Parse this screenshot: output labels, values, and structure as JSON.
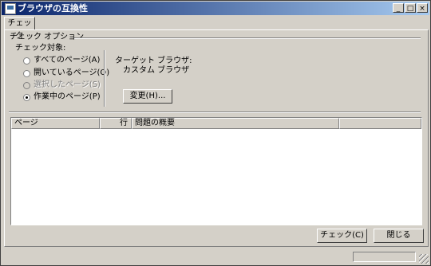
{
  "window": {
    "title": "ブラウザの互換性",
    "minimize_glyph": "_",
    "maximize_glyph": "□",
    "close_glyph": "×"
  },
  "tabs": [
    "チェック"
  ],
  "check_options": {
    "group_label": "チェック オプション",
    "target_label": "チェック対象:",
    "radios": [
      {
        "label": "すべてのページ(A)",
        "checked": false,
        "disabled": false
      },
      {
        "label": "開いているページ(O)",
        "checked": false,
        "disabled": false
      },
      {
        "label": "選択したページ(S)",
        "checked": false,
        "disabled": true
      },
      {
        "label": "作業中のページ(P)",
        "checked": true,
        "disabled": false
      }
    ],
    "target_browser_label": "ターゲット ブラウザ:",
    "target_browser_value": "カスタム ブラウザ",
    "change_button": "変更(H)..."
  },
  "results_table": {
    "columns": [
      "ページ",
      "行",
      "問題の概要"
    ],
    "rows": []
  },
  "footer": {
    "check_button": "チェック(C)",
    "close_button": "閉じる"
  }
}
